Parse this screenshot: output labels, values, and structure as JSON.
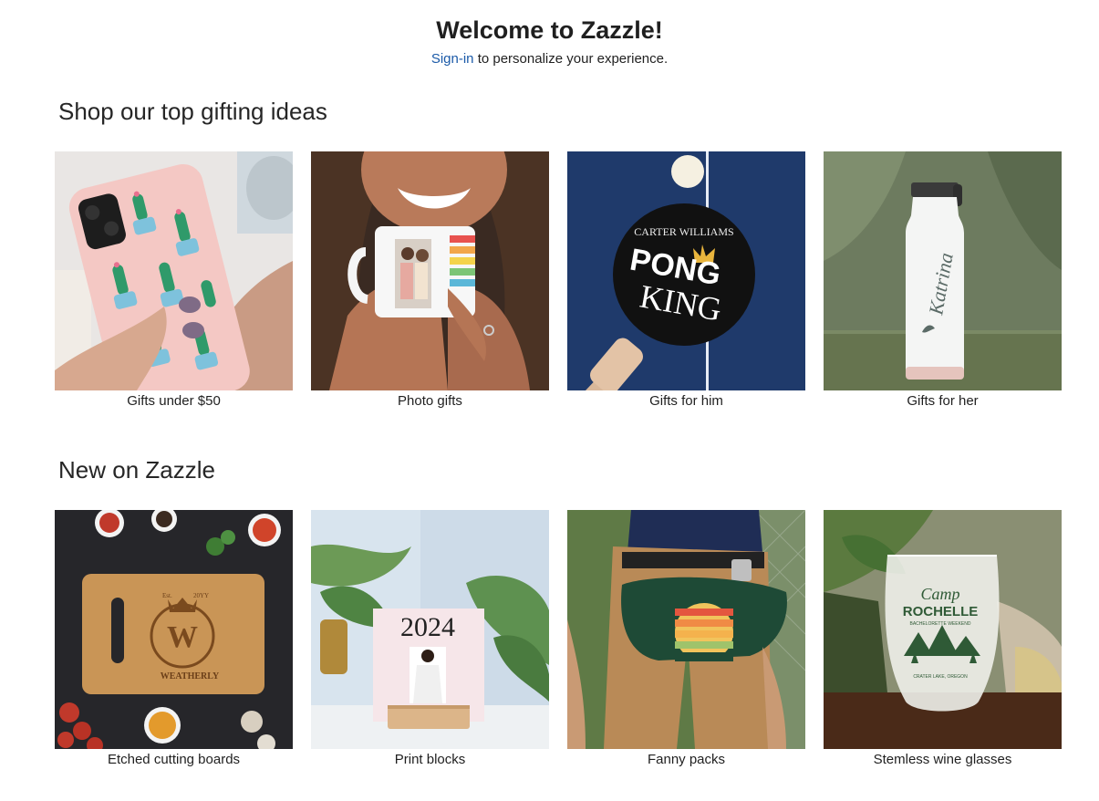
{
  "header": {
    "title": "Welcome to Zazzle!",
    "signin_link": "Sign-in",
    "signin_suffix": " to personalize your experience."
  },
  "sections": [
    {
      "title": "Shop our top gifting ideas",
      "cards": [
        {
          "label": "Gifts under $50",
          "image": "cactus-phone-case-image"
        },
        {
          "label": "Photo gifts",
          "image": "photo-mug-image"
        },
        {
          "label": "Gifts for him",
          "image": "ping-pong-paddle-image",
          "paddle_text_top": "CARTER WILLIAMS",
          "paddle_text_1": "PONG",
          "paddle_text_2": "KING"
        },
        {
          "label": "Gifts for her",
          "image": "water-bottle-image",
          "bottle_text": "Katrina"
        }
      ]
    },
    {
      "title": "New on Zazzle",
      "cards": [
        {
          "label": "Etched cutting boards",
          "image": "cutting-board-image",
          "board_est": "Est.",
          "board_year": "20YY",
          "board_monogram": "W",
          "board_name": "WEATHERLY"
        },
        {
          "label": "Print blocks",
          "image": "print-block-image",
          "block_year": "2024"
        },
        {
          "label": "Fanny packs",
          "image": "fanny-pack-image"
        },
        {
          "label": "Stemless wine glasses",
          "image": "wine-glass-image",
          "glass_text_1": "Camp",
          "glass_text_2": "ROCHELLE",
          "glass_text_3": "BACHELORETTE WEEKEND",
          "glass_text_4": "CRATER LAKE, OREGON"
        }
      ]
    }
  ],
  "colors": {
    "link": "#1b5aa8",
    "text": "#1f1f1f"
  }
}
